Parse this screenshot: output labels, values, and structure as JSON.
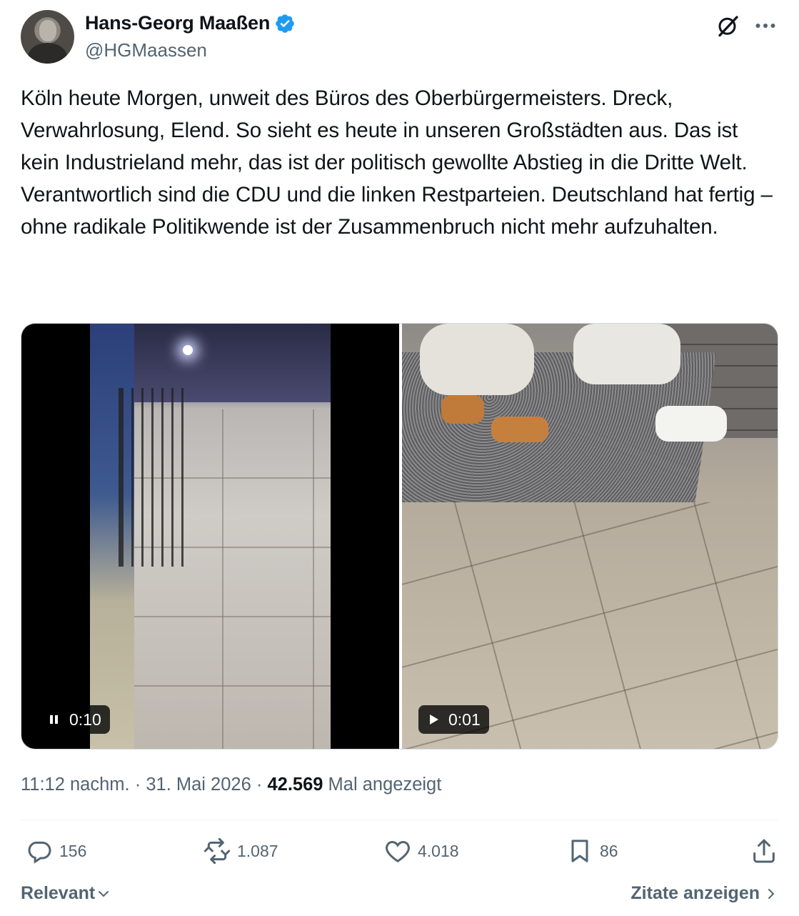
{
  "author": {
    "name": "Hans-Georg Maaßen",
    "handle": "@HGMaassen",
    "verified_color": "#1d9bf0"
  },
  "tweet": {
    "paragraphs": [
      "Köln heute Morgen, unweit des Büros des Oberbürgermeisters. Dreck, Verwahrlosung, Elend. So sieht es heute in unseren Großstädten aus. Das ist kein Industrieland mehr, das ist der politisch gewollte Abstieg in die Dritte Welt.",
      "Verantwortlich sind die CDU und die linken Restparteien. Deutschland hat fertig – ohne radikale Politikwende ist der Zusammenbruch nicht mehr aufzuhalten."
    ]
  },
  "media": {
    "video1": {
      "duration": "0:10",
      "state": "pause-icon"
    },
    "video2": {
      "duration": "0:01",
      "state": "play-icon"
    }
  },
  "meta": {
    "time": "11:12 nachm.",
    "separator": "·",
    "date": "31. Mai 2026",
    "views": "42.569",
    "views_label": "Mal angezeigt"
  },
  "actions": {
    "replies": "156",
    "reposts": "1.087",
    "likes": "4.018",
    "bookmarks": "86"
  },
  "footer": {
    "sort_label": "Relevant",
    "quotes_label": "Zitate anzeigen"
  }
}
